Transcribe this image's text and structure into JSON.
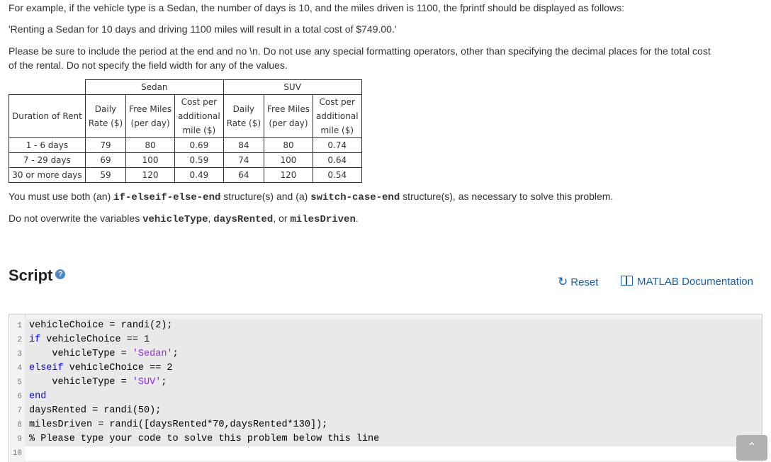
{
  "intro": {
    "line1": "For example, if the vehicle type is a Sedan, the number of days is 10, and the miles driven is 1100, the fprintf should be displayed as follows:",
    "line2": "'Renting a Sedan for 10 days and driving 1100 miles will result in a total cost of $749.00.'",
    "line3a": "Please be sure to include the period at the end and no \\n. Do not use any special formatting operators, other than specifying the decimal places for the total cost",
    "line3b": "of the rental. Do not specify the field width for any of the values."
  },
  "table": {
    "group_sedan": "Sedan",
    "group_suv": "SUV",
    "col_duration": "Duration of Rent",
    "col_daily_1": "Daily",
    "col_daily_2": "Rate ($)",
    "col_free_1": "Free Miles",
    "col_free_2": "(per day)",
    "col_cost_1": "Cost per",
    "col_cost_2": "additional",
    "col_cost_3": "mile ($)",
    "rows": [
      {
        "duration": "1 - 6 days",
        "s_rate": "79",
        "s_free": "80",
        "s_cost": "0.69",
        "v_rate": "84",
        "v_free": "80",
        "v_cost": "0.74"
      },
      {
        "duration": "7 - 29 days",
        "s_rate": "69",
        "s_free": "100",
        "s_cost": "0.59",
        "v_rate": "74",
        "v_free": "100",
        "v_cost": "0.64"
      },
      {
        "duration": "30 or more days",
        "s_rate": "59",
        "s_free": "120",
        "s_cost": "0.49",
        "v_rate": "64",
        "v_free": "120",
        "v_cost": "0.54"
      }
    ]
  },
  "instr": {
    "s1a": "You must use both (an) ",
    "s1b": "if-elseif-else-end",
    "s1c": " structure(s) and (a) ",
    "s1d": "switch-case-end",
    "s1e": " structure(s), as necessary to solve this problem.",
    "s2a": "Do not overwrite the variables ",
    "s2b": "vehicleType",
    "s2c": ", ",
    "s2d": "daysRented",
    "s2e": ", or ",
    "s2f": "milesDriven",
    "s2g": "."
  },
  "script": {
    "title": "Script",
    "help_glyph": "?",
    "reset_label": "Reset",
    "doc_label": "MATLAB Documentation"
  },
  "editor": {
    "line_numbers": [
      "1",
      "2",
      "3",
      "4",
      "5",
      "6",
      "7",
      "8",
      "9",
      "10"
    ],
    "l1": "vehicleChoice = randi(2);",
    "l2_kw": "if",
    "l2_rest": " vehicleChoice == 1",
    "l3_pre": "    vehicleType = ",
    "l3_str": "'Sedan'",
    "l3_post": ";",
    "l4_kw": "elseif",
    "l4_rest": " vehicleChoice == 2",
    "l5_pre": "    vehicleType = ",
    "l5_str": "'SUV'",
    "l5_post": ";",
    "l6_kw": "end",
    "l7": "daysRented = randi(50);",
    "l8": "milesDriven = randi([daysRented*70,daysRented*130]);",
    "l9": "% Please type your code to solve this problem below this line",
    "l10": ""
  },
  "scroll_top_glyph": "⌃",
  "colors": {
    "link": "#1a5fa8",
    "keyword": "#0000ff",
    "string": "#a020f0",
    "comment": "#228b22"
  }
}
